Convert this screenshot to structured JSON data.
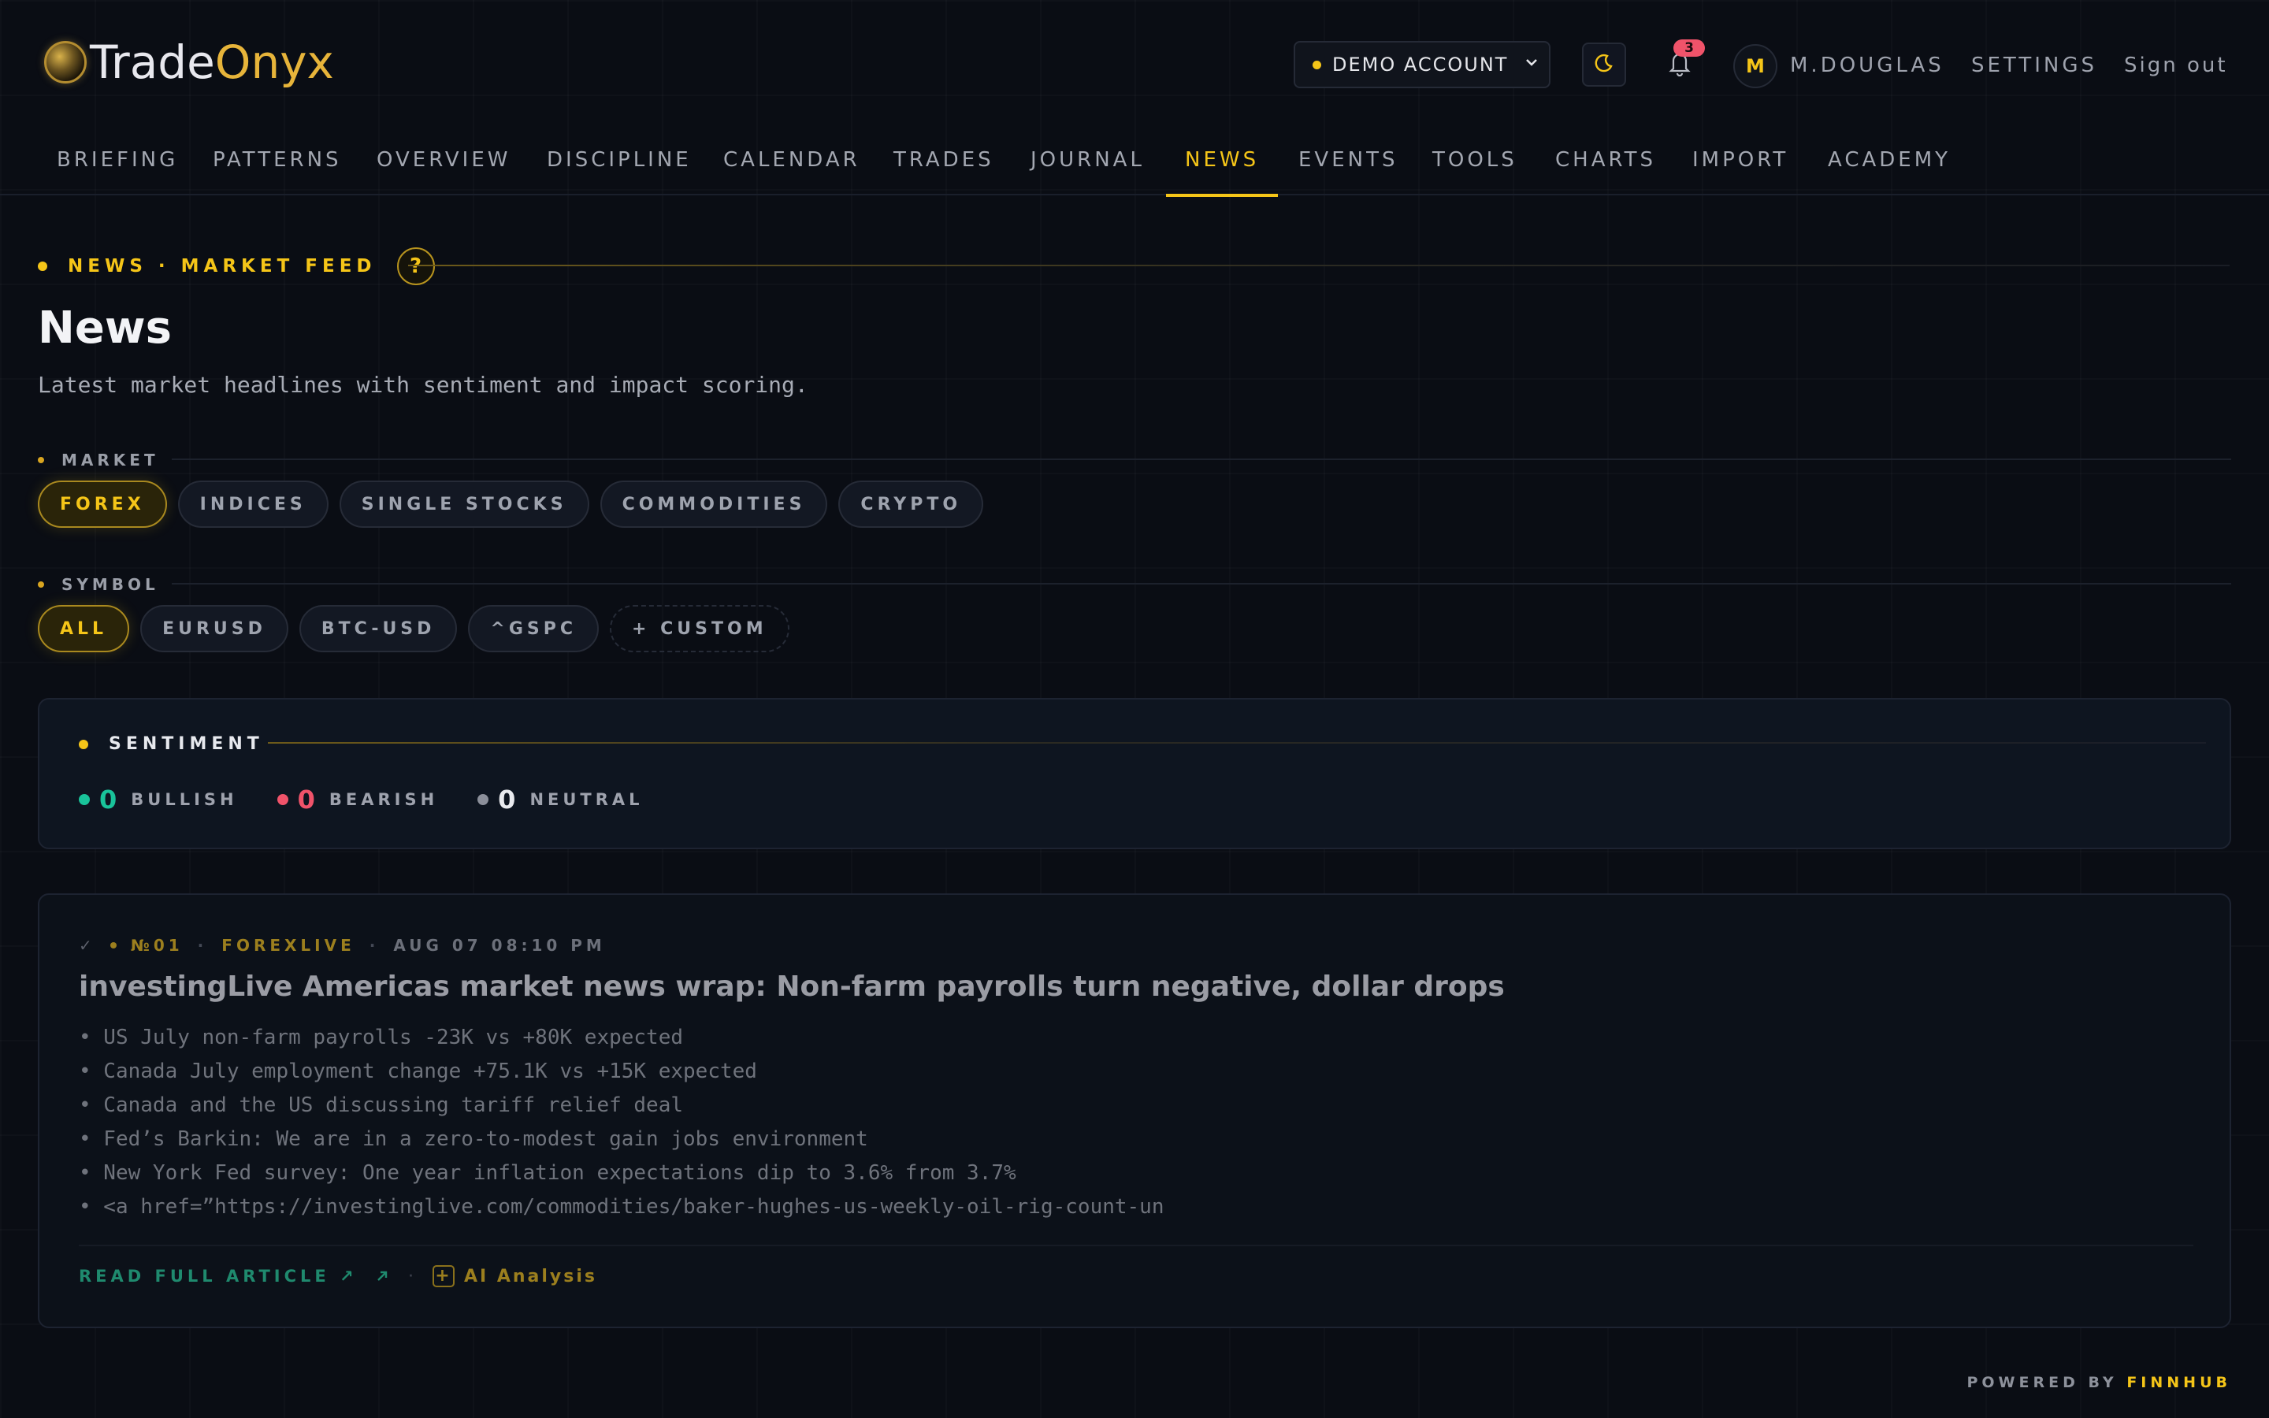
{
  "brand": {
    "name_part1": "Trade",
    "name_part2": "Onyx"
  },
  "header": {
    "account_label": "DEMO ACCOUNT",
    "notification_count": "3",
    "avatar_initial": "M",
    "user_name": "M.DOUGLAS",
    "settings_label": "SETTINGS",
    "signout_label": "Sign out"
  },
  "nav": {
    "items": [
      "BRIEFING",
      "PATTERNS",
      "OVERVIEW",
      "DISCIPLINE",
      "CALENDAR",
      "TRADES",
      "JOURNAL",
      "NEWS",
      "EVENTS",
      "TOOLS",
      "CHARTS",
      "IMPORT",
      "ACADEMY"
    ],
    "active": "NEWS"
  },
  "page": {
    "kicker": "NEWS · MARKET FEED",
    "help": "?",
    "title": "News",
    "subtitle": "Latest market headlines with sentiment and impact scoring."
  },
  "filters": {
    "market": {
      "label": "MARKET",
      "options": [
        "FOREX",
        "INDICES",
        "SINGLE STOCKS",
        "COMMODITIES",
        "CRYPTO"
      ],
      "selected": "FOREX"
    },
    "symbol": {
      "label": "SYMBOL",
      "options": [
        "ALL",
        "EURUSD",
        "BTC-USD",
        "^GSPC",
        "+ CUSTOM"
      ],
      "selected": "ALL"
    }
  },
  "sentiment": {
    "title": "SENTIMENT",
    "bullish": {
      "count": "0",
      "label": "BULLISH",
      "color": "#19c39a"
    },
    "bearish": {
      "count": "0",
      "label": "BEARISH",
      "color": "#f0536a"
    },
    "neutral": {
      "count": "0",
      "label": "NEUTRAL",
      "color": "#8b8f9a"
    }
  },
  "news": [
    {
      "number": "№01",
      "source": "FOREXLIVE",
      "time": "AUG 07 08:10 PM",
      "title": "investingLive Americas market news wrap: Non-farm payrolls turn negative, dollar drops",
      "bullets": [
        "• US July non-farm payrolls -23K vs +80K expected",
        "• Canada July employment change +75.1K vs +15K expected",
        "• Canada and the US discussing tariff relief deal",
        "• Fed’s Barkin: We are in a zero-to-modest gain jobs environment",
        "• New York Fed survey: One year inflation expectations dip to 3.6% from 3.7%",
        "• <a href=”https://investinglive.com/commodities/baker-hughes-us-weekly-oil-rig-count-un"
      ],
      "read_label": "READ FULL ARTICLE ↗",
      "ai_label": "AI Analysis"
    }
  ],
  "footer": {
    "powered_prefix": "POWERED BY",
    "powered_brand": "FINNHUB"
  },
  "colors": {
    "accent": "#f5c518",
    "bullish": "#19c39a",
    "bearish": "#f0536a"
  }
}
